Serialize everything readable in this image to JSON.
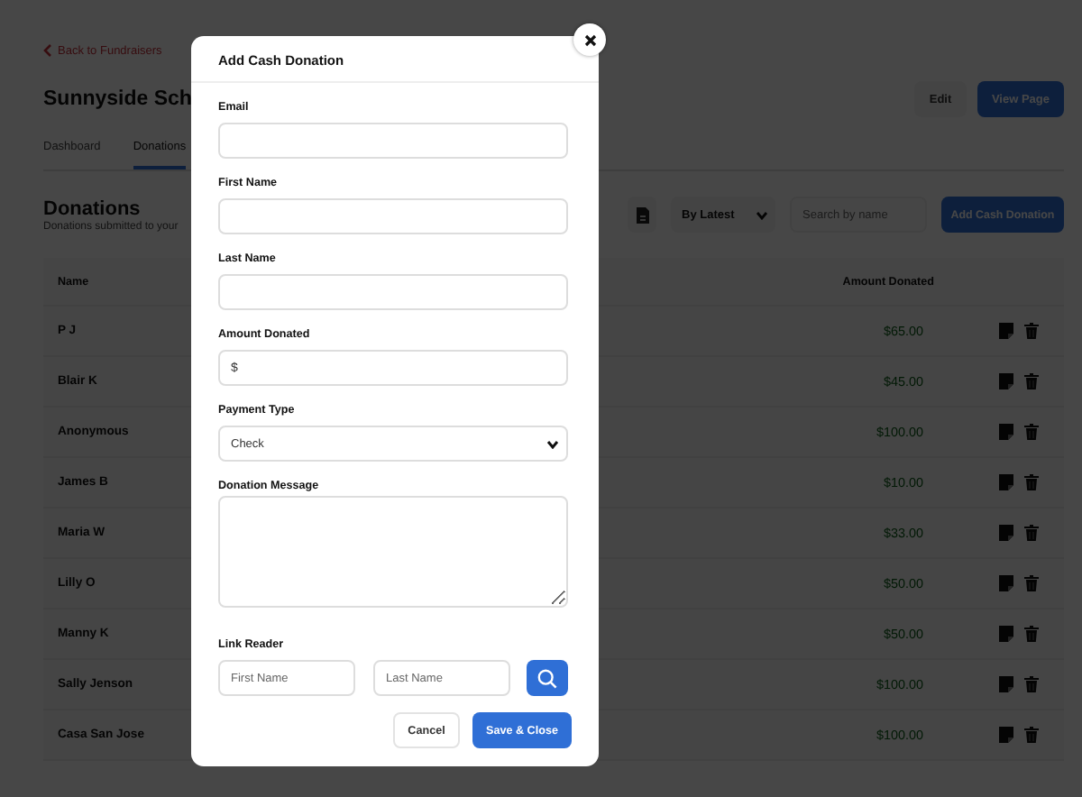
{
  "back_link": "Back to Fundraisers",
  "page_title": "Sunnyside Sch",
  "header_buttons": [
    {
      "label": "Edit",
      "kind": "secondary"
    },
    {
      "label": "View Page",
      "kind": "primary"
    }
  ],
  "tabs": [
    {
      "label": "Dashboard",
      "selected": false
    },
    {
      "label": "Donations",
      "selected": true
    }
  ],
  "section": {
    "title": "Donations",
    "subtitle": "Donations submitted to your"
  },
  "toolbar": {
    "sort": "By Latest",
    "search": {
      "placeholder": "Search by name"
    },
    "add_button": "Add Cash Donation"
  },
  "table": {
    "columns": [
      "Name",
      "Amount Donated"
    ],
    "rows": [
      {
        "name": "P J",
        "amount": "$65.00"
      },
      {
        "name": "Blair K",
        "amount": "$45.00"
      },
      {
        "name": "Anonymous",
        "amount": "$100.00"
      },
      {
        "name": "James B",
        "amount": "$10.00"
      },
      {
        "name": "Maria W",
        "amount": "$33.00"
      },
      {
        "name": "Lilly O",
        "amount": "$50.00"
      },
      {
        "name": "Manny K",
        "amount": "$50.00"
      },
      {
        "name": "Sally Jenson",
        "amount": "$100.00"
      },
      {
        "name": "Casa San Jose",
        "amount": "$100.00"
      }
    ]
  },
  "modal": {
    "title": "Add Cash Donation",
    "fields": [
      {
        "kind": "text",
        "label": "Email"
      },
      {
        "kind": "text",
        "label": "First Name"
      },
      {
        "kind": "text",
        "label": "Last Name"
      },
      {
        "kind": "amount",
        "label": "Amount Donated",
        "prefix": "$"
      },
      {
        "kind": "select",
        "label": "Payment Type",
        "value": "Check"
      },
      {
        "kind": "textarea",
        "label": "Donation Message"
      }
    ],
    "link_reader": {
      "label": "Link Reader",
      "first_name": {
        "placeholder": "First Name"
      },
      "last_name": {
        "placeholder": "Last Name"
      }
    },
    "buttons": [
      {
        "label": "Cancel",
        "kind": "secondary"
      },
      {
        "label": "Save & Close",
        "kind": "primary"
      }
    ]
  }
}
